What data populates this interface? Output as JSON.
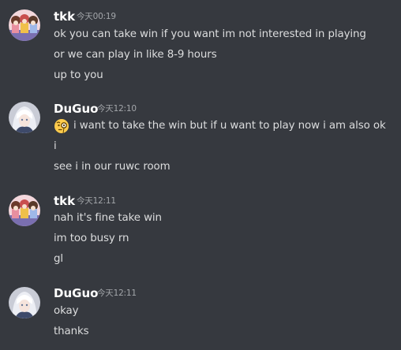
{
  "messages": [
    {
      "author": "tkk",
      "timestamp": "今天00:19",
      "lines": [
        "ok you can take win if you want im not interested in playing",
        "or we can play in like 8-9 hours",
        "up to you"
      ]
    },
    {
      "author": "DuGuo",
      "timestamp": "今天12:10",
      "emoji": "face-with-monocle-emoji",
      "lines": [
        "i want to take the win but if u want to play now i am also ok",
        "i",
        "see i in our ruwc room"
      ]
    },
    {
      "author": "tkk",
      "timestamp": "今天12:11",
      "lines": [
        "nah it's fine take win",
        "im too busy rn",
        "gl"
      ]
    },
    {
      "author": "DuGuo",
      "timestamp": "今天12:11",
      "lines": [
        "okay",
        "thanks"
      ]
    }
  ],
  "colors": {
    "background": "#36393f",
    "username": "#ffffff",
    "message_text": "#dcddde",
    "timestamp": "#a3a6aa"
  }
}
